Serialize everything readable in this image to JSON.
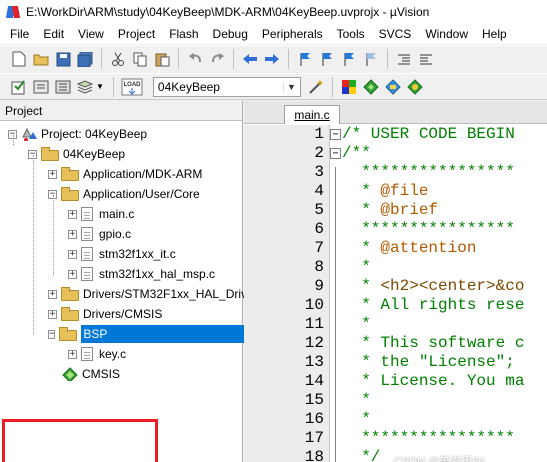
{
  "window": {
    "title": "E:\\WorkDir\\ARM\\study\\04KeyBeep\\MDK-ARM\\04KeyBeep.uvprojx - µVision"
  },
  "menu": [
    "File",
    "Edit",
    "View",
    "Project",
    "Flash",
    "Debug",
    "Peripherals",
    "Tools",
    "SVCS",
    "Window",
    "Help"
  ],
  "toolbar2": {
    "target": "04KeyBeep",
    "load_icon_text": "LOAD"
  },
  "project_panel": {
    "title": "Project",
    "tree": {
      "root": "Project: 04KeyBeep",
      "target": "04KeyBeep",
      "groups": {
        "app_mdk": "Application/MDK-ARM",
        "app_core": "Application/User/Core",
        "core_files": [
          "main.c",
          "gpio.c",
          "stm32f1xx_it.c",
          "stm32f1xx_hal_msp.c"
        ],
        "drivers_hal": "Drivers/STM32F1xx_HAL_Driv",
        "drivers_cmsis": "Drivers/CMSIS",
        "bsp": "BSP",
        "bsp_file": "key.c",
        "cmsis": "CMSIS"
      }
    }
  },
  "editor": {
    "tab": "main.c",
    "lines": [
      {
        "n": "1",
        "text": "/* USER CODE BEGIN"
      },
      {
        "n": "2",
        "text": "/**"
      },
      {
        "n": "3",
        "text": "  ****************"
      },
      {
        "n": "4",
        "pre": "  * ",
        "kw": "@file",
        "post": ""
      },
      {
        "n": "5",
        "pre": "  * ",
        "kw": "@brief",
        "post": ""
      },
      {
        "n": "6",
        "text": "  ****************"
      },
      {
        "n": "7",
        "pre": "  * ",
        "kw": "@attention",
        "post": ""
      },
      {
        "n": "8",
        "text": "  *"
      },
      {
        "n": "9",
        "pre": "  * ",
        "tag": "<h2><center>&co",
        "post": ""
      },
      {
        "n": "10",
        "text": "  * All rights rese"
      },
      {
        "n": "11",
        "text": "  *"
      },
      {
        "n": "12",
        "text": "  * This software c"
      },
      {
        "n": "13",
        "text": "  * the \"License\";"
      },
      {
        "n": "14",
        "text": "  * License. You ma"
      },
      {
        "n": "15",
        "text": "  *"
      },
      {
        "n": "16",
        "text": "  *"
      },
      {
        "n": "17",
        "text": "  ****************"
      },
      {
        "n": "18",
        "text": "  */"
      }
    ]
  },
  "watermark": "CSDN @笑春风60"
}
